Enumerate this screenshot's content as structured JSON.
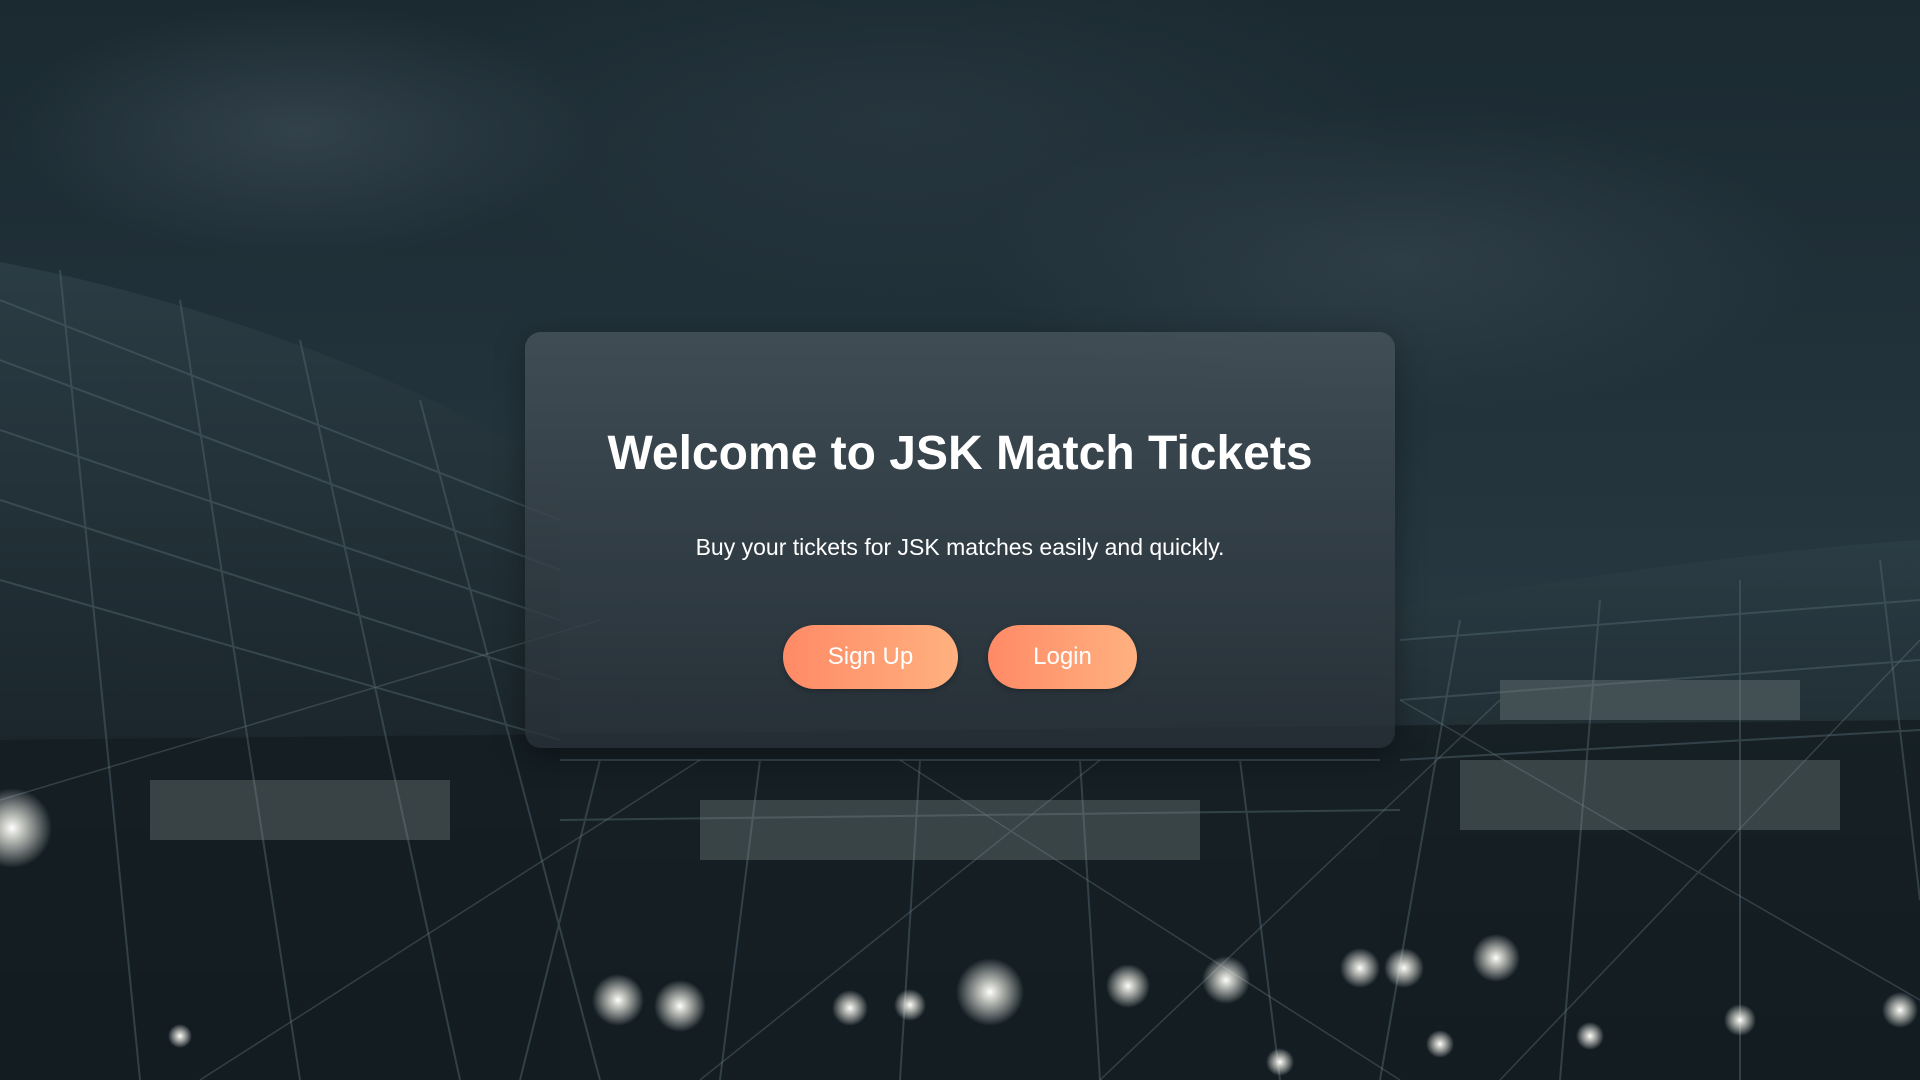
{
  "hero": {
    "title": "Welcome to JSK Match Tickets",
    "subtitle": "Buy your tickets for JSK matches easily and quickly.",
    "signup_label": "Sign Up",
    "login_label": "Login"
  },
  "colors": {
    "button_gradient_start": "#ff8a66",
    "button_gradient_end": "#ffb17f",
    "text": "#ffffff"
  }
}
